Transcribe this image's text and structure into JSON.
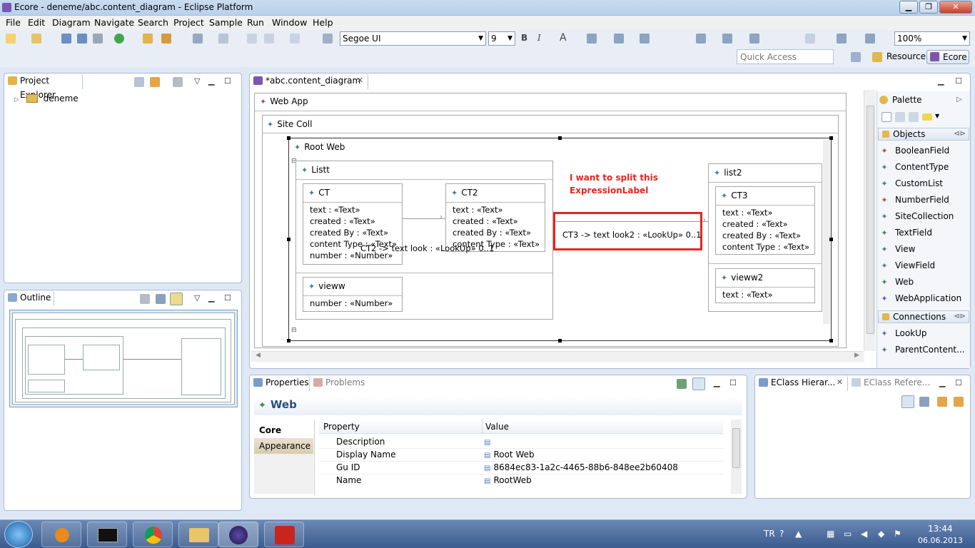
{
  "window": {
    "title": "Ecore - deneme/abc.content_diagram - Eclipse Platform",
    "minimize": "▁",
    "restore": "❐",
    "close": "✕"
  },
  "menu": [
    "File",
    "Edit",
    "Diagram",
    "Navigate",
    "Search",
    "Project",
    "Sample",
    "Run",
    "Window",
    "Help"
  ],
  "toolbar": {
    "font_name": "Segoe UI",
    "font_size": "9",
    "bold": "B",
    "italic": "I",
    "font_color": "A",
    "zoom": "100%",
    "quick_access": "Quick Access",
    "resource": "Resource",
    "ecore": "Ecore"
  },
  "project_explorer": {
    "tab": "Project Explorer",
    "items": [
      "deneme"
    ]
  },
  "outline": {
    "tab": "Outline"
  },
  "editor": {
    "tab": "*abc.content_diagram"
  },
  "diagram": {
    "web_app": "Web App",
    "site_coll": "Site Coll",
    "root_web": "Root Web",
    "listt": "Listt",
    "ct": {
      "title": "CT",
      "attrs": [
        "text : «Text»",
        "created : «Text»",
        "created By : «Text»",
        "content Type : «Text»",
        "number : «Number»"
      ]
    },
    "ct2": {
      "title": "CT2",
      "attrs": [
        "text : «Text»",
        "created : «Text»",
        "created By : «Text»",
        "content Type : «Text»"
      ]
    },
    "vieww": {
      "title": "vieww",
      "attrs": [
        "number : «Number»"
      ]
    },
    "list2": "list2",
    "ct3": {
      "title": "CT3",
      "attrs": [
        "text : «Text»",
        "created : «Text»",
        "created By : «Text»",
        "content Type : «Text»"
      ]
    },
    "vieww2": {
      "title": "vieww2",
      "attrs": [
        "text : «Text»"
      ]
    },
    "link1_label": "CT2 -> text   look : «LookUp»  0..1",
    "link2_label": "CT3 -> text   look2 : «LookUp»  0..1",
    "annotation": "I want to split this ExpressionLabel",
    "annotation_color": "#e8251f"
  },
  "palette": {
    "title": "Palette",
    "objects_drawer": "Objects",
    "objects": [
      "BooleanField",
      "ContentType",
      "CustomList",
      "NumberField",
      "SiteCollection",
      "TextField",
      "View",
      "ViewField",
      "Web",
      "WebApplication"
    ],
    "connections_drawer": "Connections",
    "connections": [
      "LookUp",
      "ParentContent..."
    ]
  },
  "properties": {
    "tab": "Properties",
    "problems_tab": "Problems",
    "heading": "Web",
    "side_tabs": [
      "Core",
      "Appearance"
    ],
    "col_property": "Property",
    "col_value": "Value",
    "rows": [
      {
        "property": "Description",
        "value": ""
      },
      {
        "property": "Display Name",
        "value": "Root Web"
      },
      {
        "property": "Gu ID",
        "value": "8684ec83-1a2c-4465-88b6-848ee2b60408"
      },
      {
        "property": "Name",
        "value": "RootWeb"
      }
    ]
  },
  "eclass": {
    "hier_tab": "EClass Hierar...",
    "ref_tab": "EClass Refere..."
  },
  "taskbar": {
    "lang": "TR",
    "time": "13:44",
    "date": "06.06.2013"
  }
}
